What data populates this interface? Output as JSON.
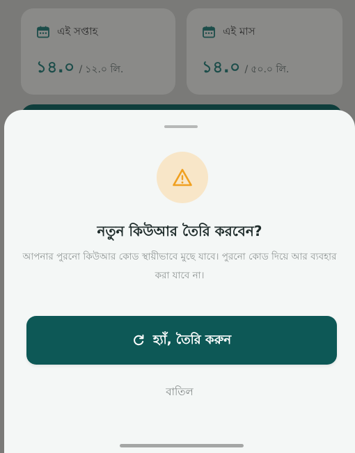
{
  "stats": {
    "week": {
      "label": "এই সপ্তাহ",
      "value": "১৪.০",
      "separator": "/",
      "total": "১২.০ লি.",
      "icon": "calendar-icon"
    },
    "month": {
      "label": "এই মাস",
      "value": "১৪.০",
      "separator": "/",
      "total": "৫০.০ লি.",
      "icon": "calendar-icon"
    }
  },
  "dialog": {
    "icon": "warning-icon",
    "title": "নতুন কিউআর তৈরি করবেন?",
    "message": "আপনার পুরনো কিউআর কোড স্থায়ীভাবে মুছে যাবে। পুরনো কোড দিয়ে আর ব্যবহার করা যাবে না।",
    "confirm_icon": "refresh-icon",
    "confirm_label": "হ্যাঁ, তৈরি করুন",
    "cancel_label": "বাতিল"
  },
  "colors": {
    "primary": "#0d5856",
    "warning_bg": "#f8e6c8",
    "warning_fg": "#f0a020",
    "sheet_bg": "#f4f7f6",
    "scrim": "#7a7a78"
  }
}
